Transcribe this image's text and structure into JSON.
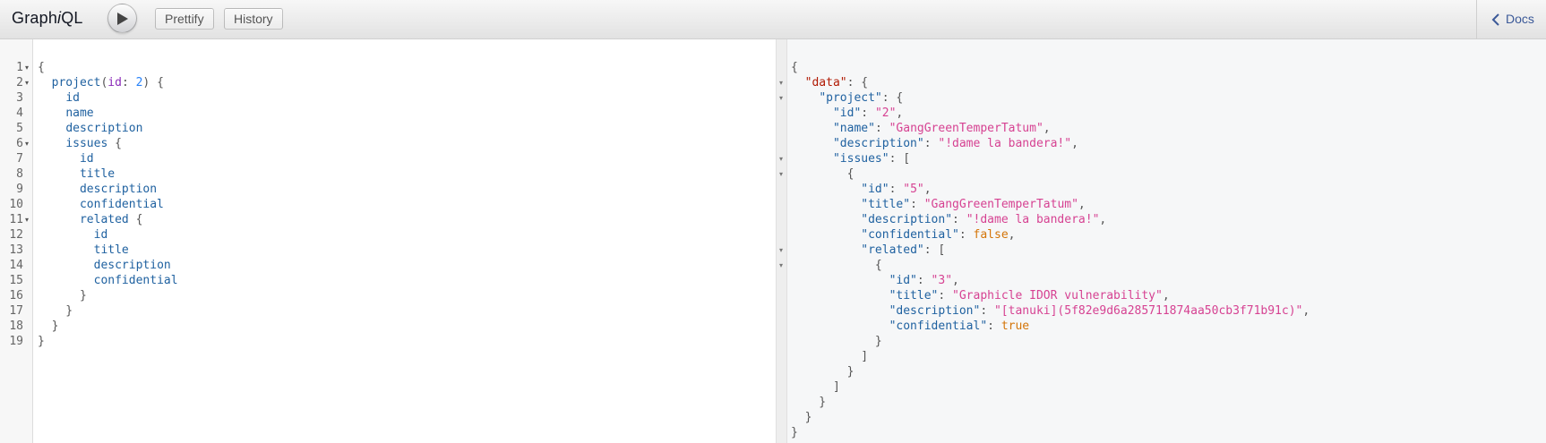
{
  "topbar": {
    "title_prefix": "Graph",
    "title_italic": "i",
    "title_suffix": "QL",
    "run_icon": "play-icon",
    "prettify_label": "Prettify",
    "history_label": "History",
    "docs_label": "Docs",
    "docs_icon": "chevron-left-icon"
  },
  "editor": {
    "line_numbers": [
      "1",
      "2",
      "3",
      "4",
      "5",
      "6",
      "7",
      "8",
      "9",
      "10",
      "11",
      "12",
      "13",
      "14",
      "15",
      "16",
      "17",
      "18",
      "19"
    ],
    "folded_lines": [
      1,
      2,
      6,
      11
    ],
    "lines": [
      [
        {
          "t": "{",
          "c": "punct"
        }
      ],
      [
        {
          "t": "  ",
          "c": "punct"
        },
        {
          "t": "project",
          "c": "field"
        },
        {
          "t": "(",
          "c": "punct"
        },
        {
          "t": "id",
          "c": "arg"
        },
        {
          "t": ": ",
          "c": "punct"
        },
        {
          "t": "2",
          "c": "num"
        },
        {
          "t": ") {",
          "c": "punct"
        }
      ],
      [
        {
          "t": "    ",
          "c": "punct"
        },
        {
          "t": "id",
          "c": "field"
        }
      ],
      [
        {
          "t": "    ",
          "c": "punct"
        },
        {
          "t": "name",
          "c": "field"
        }
      ],
      [
        {
          "t": "    ",
          "c": "punct"
        },
        {
          "t": "description",
          "c": "field"
        }
      ],
      [
        {
          "t": "    ",
          "c": "punct"
        },
        {
          "t": "issues",
          "c": "field"
        },
        {
          "t": " {",
          "c": "punct"
        }
      ],
      [
        {
          "t": "      ",
          "c": "punct"
        },
        {
          "t": "id",
          "c": "field"
        }
      ],
      [
        {
          "t": "      ",
          "c": "punct"
        },
        {
          "t": "title",
          "c": "field"
        }
      ],
      [
        {
          "t": "      ",
          "c": "punct"
        },
        {
          "t": "description",
          "c": "field"
        }
      ],
      [
        {
          "t": "      ",
          "c": "punct"
        },
        {
          "t": "confidential",
          "c": "field"
        }
      ],
      [
        {
          "t": "      ",
          "c": "punct"
        },
        {
          "t": "related",
          "c": "field"
        },
        {
          "t": " {",
          "c": "punct"
        }
      ],
      [
        {
          "t": "        ",
          "c": "punct"
        },
        {
          "t": "id",
          "c": "field"
        }
      ],
      [
        {
          "t": "        ",
          "c": "punct"
        },
        {
          "t": "title",
          "c": "field"
        }
      ],
      [
        {
          "t": "        ",
          "c": "punct"
        },
        {
          "t": "description",
          "c": "field"
        }
      ],
      [
        {
          "t": "        ",
          "c": "punct"
        },
        {
          "t": "confidential",
          "c": "field"
        }
      ],
      [
        {
          "t": "      }",
          "c": "punct"
        }
      ],
      [
        {
          "t": "    }",
          "c": "punct"
        }
      ],
      [
        {
          "t": "  }",
          "c": "punct"
        }
      ],
      [
        {
          "t": "}",
          "c": "punct"
        }
      ]
    ]
  },
  "result": {
    "folded_lines": [
      2,
      3,
      7,
      8,
      13,
      14
    ],
    "lines": [
      [
        {
          "t": "{",
          "c": "punct"
        }
      ],
      [
        {
          "t": "  ",
          "c": "punct"
        },
        {
          "t": "\"data\"",
          "c": "data-key"
        },
        {
          "t": ": {",
          "c": "punct"
        }
      ],
      [
        {
          "t": "    ",
          "c": "punct"
        },
        {
          "t": "\"project\"",
          "c": "key"
        },
        {
          "t": ": {",
          "c": "punct"
        }
      ],
      [
        {
          "t": "      ",
          "c": "punct"
        },
        {
          "t": "\"id\"",
          "c": "key"
        },
        {
          "t": ": ",
          "c": "punct"
        },
        {
          "t": "\"2\"",
          "c": "str"
        },
        {
          "t": ",",
          "c": "punct"
        }
      ],
      [
        {
          "t": "      ",
          "c": "punct"
        },
        {
          "t": "\"name\"",
          "c": "key"
        },
        {
          "t": ": ",
          "c": "punct"
        },
        {
          "t": "\"GangGreenTemperTatum\"",
          "c": "str"
        },
        {
          "t": ",",
          "c": "punct"
        }
      ],
      [
        {
          "t": "      ",
          "c": "punct"
        },
        {
          "t": "\"description\"",
          "c": "key"
        },
        {
          "t": ": ",
          "c": "punct"
        },
        {
          "t": "\"!dame la bandera!\"",
          "c": "str"
        },
        {
          "t": ",",
          "c": "punct"
        }
      ],
      [
        {
          "t": "      ",
          "c": "punct"
        },
        {
          "t": "\"issues\"",
          "c": "key"
        },
        {
          "t": ": [",
          "c": "punct"
        }
      ],
      [
        {
          "t": "        {",
          "c": "punct"
        }
      ],
      [
        {
          "t": "          ",
          "c": "punct"
        },
        {
          "t": "\"id\"",
          "c": "key"
        },
        {
          "t": ": ",
          "c": "punct"
        },
        {
          "t": "\"5\"",
          "c": "str"
        },
        {
          "t": ",",
          "c": "punct"
        }
      ],
      [
        {
          "t": "          ",
          "c": "punct"
        },
        {
          "t": "\"title\"",
          "c": "key"
        },
        {
          "t": ": ",
          "c": "punct"
        },
        {
          "t": "\"GangGreenTemperTatum\"",
          "c": "str"
        },
        {
          "t": ",",
          "c": "punct"
        }
      ],
      [
        {
          "t": "          ",
          "c": "punct"
        },
        {
          "t": "\"description\"",
          "c": "key"
        },
        {
          "t": ": ",
          "c": "punct"
        },
        {
          "t": "\"!dame la bandera!\"",
          "c": "str"
        },
        {
          "t": ",",
          "c": "punct"
        }
      ],
      [
        {
          "t": "          ",
          "c": "punct"
        },
        {
          "t": "\"confidential\"",
          "c": "key"
        },
        {
          "t": ": ",
          "c": "punct"
        },
        {
          "t": "false",
          "c": "bool"
        },
        {
          "t": ",",
          "c": "punct"
        }
      ],
      [
        {
          "t": "          ",
          "c": "punct"
        },
        {
          "t": "\"related\"",
          "c": "key"
        },
        {
          "t": ": [",
          "c": "punct"
        }
      ],
      [
        {
          "t": "            {",
          "c": "punct"
        }
      ],
      [
        {
          "t": "              ",
          "c": "punct"
        },
        {
          "t": "\"id\"",
          "c": "key"
        },
        {
          "t": ": ",
          "c": "punct"
        },
        {
          "t": "\"3\"",
          "c": "str"
        },
        {
          "t": ",",
          "c": "punct"
        }
      ],
      [
        {
          "t": "              ",
          "c": "punct"
        },
        {
          "t": "\"title\"",
          "c": "key"
        },
        {
          "t": ": ",
          "c": "punct"
        },
        {
          "t": "\"Graphicle IDOR vulnerability\"",
          "c": "str"
        },
        {
          "t": ",",
          "c": "punct"
        }
      ],
      [
        {
          "t": "              ",
          "c": "punct"
        },
        {
          "t": "\"description\"",
          "c": "key"
        },
        {
          "t": ": ",
          "c": "punct"
        },
        {
          "t": "\"[tanuki](5f82e9d6a285711874aa50cb3f71b91c)\"",
          "c": "str"
        },
        {
          "t": ",",
          "c": "punct"
        }
      ],
      [
        {
          "t": "              ",
          "c": "punct"
        },
        {
          "t": "\"confidential\"",
          "c": "key"
        },
        {
          "t": ": ",
          "c": "punct"
        },
        {
          "t": "true",
          "c": "bool"
        }
      ],
      [
        {
          "t": "            }",
          "c": "punct"
        }
      ],
      [
        {
          "t": "          ]",
          "c": "punct"
        }
      ],
      [
        {
          "t": "        }",
          "c": "punct"
        }
      ],
      [
        {
          "t": "      ]",
          "c": "punct"
        }
      ],
      [
        {
          "t": "    }",
          "c": "punct"
        }
      ],
      [
        {
          "t": "  }",
          "c": "punct"
        }
      ],
      [
        {
          "t": "}",
          "c": "punct"
        }
      ]
    ]
  },
  "colors": {
    "field": "#1f61a0",
    "argument": "#8b2bb9",
    "number": "#2882f9",
    "string": "#d64292",
    "boolean": "#d47509",
    "docs_link": "#3b5998"
  }
}
